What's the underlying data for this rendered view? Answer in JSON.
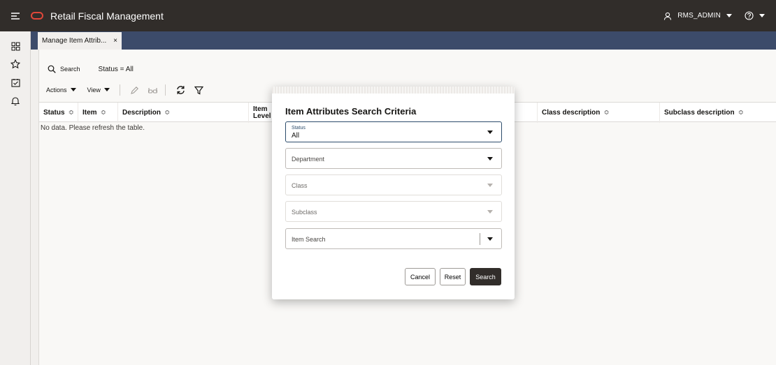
{
  "app": {
    "title": "Retail Fiscal Management"
  },
  "user": {
    "name": "RMS_ADMIN"
  },
  "tab": {
    "label": "Manage Item Attrib...",
    "close": "×"
  },
  "search": {
    "label": "Search",
    "status_filter": "Status = All"
  },
  "toolbar": {
    "actions": "Actions",
    "view": "View"
  },
  "table": {
    "columns": [
      {
        "label": "Status",
        "sortable": true
      },
      {
        "label": "Item",
        "sortable": true
      },
      {
        "label": "Description",
        "sortable": true
      },
      {
        "label": "Item",
        "label2": "Level",
        "sortable": false
      },
      {
        "label": "Class description",
        "sortable": true
      },
      {
        "label": "Subclass description",
        "sortable": true
      }
    ],
    "empty_message": "No data. Please refresh the table."
  },
  "dialog": {
    "title": "Item Attributes Search Criteria",
    "status_label": "Status",
    "status_value": "All",
    "department_label": "Department",
    "class_label": "Class",
    "subclass_label": "Subclass",
    "item_search_label": "Item Search",
    "cancel": "Cancel",
    "reset": "Reset",
    "search": "Search"
  },
  "colors": {
    "topbar": "#312d2a",
    "tabstrip": "#3c4b6a",
    "logo": "#e0473a",
    "primary_button": "#312d2a"
  }
}
